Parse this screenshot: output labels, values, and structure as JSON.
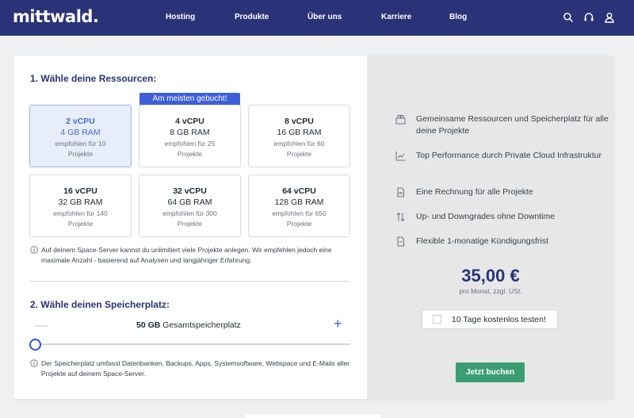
{
  "header": {
    "logo": "mittwald.",
    "nav": [
      "Hosting",
      "Produkte",
      "Über uns",
      "Karriere",
      "Blog"
    ],
    "icons": [
      "search-icon",
      "headset-icon",
      "user-icon"
    ]
  },
  "resources": {
    "heading": "1. Wähle deine Ressourcen:",
    "badge": "Am meisten gebucht!",
    "plans": [
      {
        "cpu": "2 vCPU",
        "ram": "4 GB RAM",
        "rec1": "empfohlen für 10",
        "rec2": "Projekte",
        "selected": true
      },
      {
        "cpu": "4 vCPU",
        "ram": "8 GB RAM",
        "rec1": "empfohlen für 25",
        "rec2": "Projekte",
        "selected": false
      },
      {
        "cpu": "8 vCPU",
        "ram": "16 GB RAM",
        "rec1": "empfohlen für 60",
        "rec2": "Projekte",
        "selected": false
      },
      {
        "cpu": "16 vCPU",
        "ram": "32 GB RAM",
        "rec1": "empfohlen für 140",
        "rec2": "Projekte",
        "selected": false
      },
      {
        "cpu": "32 vCPU",
        "ram": "64 GB RAM",
        "rec1": "empfohlen für 300",
        "rec2": "Projekte",
        "selected": false
      },
      {
        "cpu": "64 vCPU",
        "ram": "128 GB RAM",
        "rec1": "empfohlen für 650",
        "rec2": "Projekte",
        "selected": false
      }
    ],
    "note": "Auf deinem Space-Server kannst du unlimitiert viele Projekte anlegen. Wir empfehlen jedoch eine maximale Anzahl - basierend auf Analysen und langjähriger Erfahrung."
  },
  "storage": {
    "heading": "2. Wähle deinen Speicherplatz:",
    "amount": "50 GB",
    "label": "Gesamtspeicherplatz",
    "minus": "—",
    "plus": "+",
    "slider_level": 0,
    "note": "Der Speicherplatz umfasst Datenbanken, Backups, Apps, Systemsoftware, Webspace und E-Mails aller Projekte auf deinem Space-Server."
  },
  "summary": {
    "features": [
      {
        "icon": "shared-resources-icon",
        "text": "Gemeinsame Ressourcen und Speicherplatz für alle deine Projekte"
      },
      {
        "icon": "performance-chart-icon",
        "text": "Top Performance durch Private Cloud Infrastruktur"
      },
      {
        "icon": "invoice-icon",
        "text": "Eine Rechnung für alle Projekte"
      },
      {
        "icon": "up-down-arrows-icon",
        "text": "Up- und Downgrades ohne Downtime"
      },
      {
        "icon": "document-icon",
        "text": "Flexible 1-monatige Kündigungsfrist"
      }
    ],
    "price": "35,00 €",
    "price_note": "pro Monat, zzgl. USt.",
    "trial_label": "10 Tage kostenlos testen!",
    "cta": "Jetzt buchen"
  }
}
